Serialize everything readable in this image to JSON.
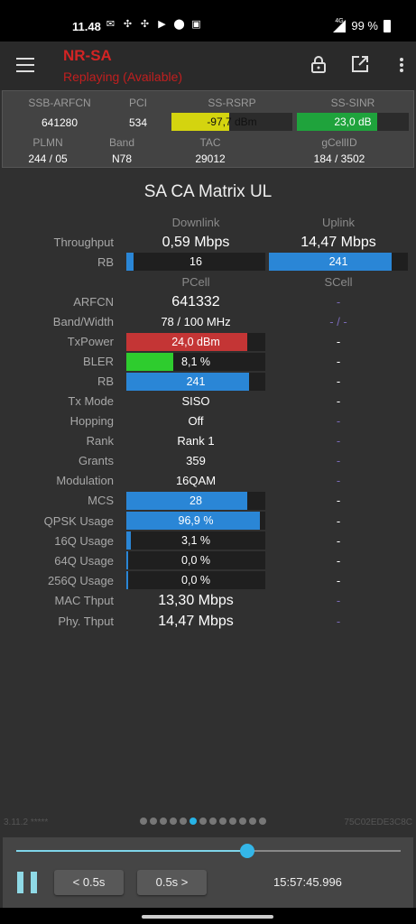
{
  "status_bar": {
    "time": "11.48",
    "network": "4G",
    "battery": "99 %"
  },
  "app_bar": {
    "title": "NR-SA",
    "subtitle": "Replaying (Available)"
  },
  "summary": {
    "ssb_arfcn_label": "SSB-ARFCN",
    "ssb_arfcn": "641280",
    "pci_label": "PCI",
    "pci": "534",
    "rsrp_label": "SS-RSRP",
    "rsrp": "-97,7 dBm",
    "rsrp_level": 0.48,
    "rsrp_color": "#d4d40f",
    "sinr_label": "SS-SINR",
    "sinr": "23,0 dB",
    "sinr_level": 0.72,
    "sinr_color": "#1fa33c",
    "plmn_label": "PLMN",
    "plmn": "244 / 05",
    "band_label": "Band",
    "band": "N78",
    "tac_label": "TAC",
    "tac": "29012",
    "gcellid_label": "gCellID",
    "gcellid": "184 / 3502"
  },
  "section_title": "SA CA Matrix UL",
  "headers": {
    "downlink": "Downlink",
    "uplink": "Uplink",
    "pcell": "PCell",
    "scell": "SCell"
  },
  "throughput": {
    "label": "Throughput",
    "downlink": "0,59 Mbps",
    "uplink": "14,47 Mbps"
  },
  "rb_top": {
    "label": "RB",
    "downlink": "16",
    "downlink_level": 0.05,
    "uplink": "241",
    "uplink_level": 0.88
  },
  "rows": {
    "arfcn": {
      "label": "ARFCN",
      "pcell": "641332",
      "scell": "-"
    },
    "band_width": {
      "label": "Band/Width",
      "pcell": "78 / 100 MHz",
      "scell": "- / -"
    },
    "txpower": {
      "label": "TxPower",
      "pcell": "24,0 dBm",
      "level": 0.87,
      "color": "#c43535",
      "scell": "-"
    },
    "bler": {
      "label": "BLER",
      "pcell": "8,1 %",
      "level": 0.34,
      "color": "#2ecc2e",
      "scell": "-"
    },
    "rb": {
      "label": "RB",
      "pcell": "241",
      "level": 0.88,
      "color": "#2a86d6",
      "scell": "-"
    },
    "tx_mode": {
      "label": "Tx Mode",
      "pcell": "SISO",
      "scell": "-"
    },
    "hopping": {
      "label": "Hopping",
      "pcell": "Off",
      "scell": "-"
    },
    "rank": {
      "label": "Rank",
      "pcell": "Rank 1",
      "scell": "-"
    },
    "grants": {
      "label": "Grants",
      "pcell": "359",
      "scell": "-"
    },
    "modulation": {
      "label": "Modulation",
      "pcell": "16QAM",
      "scell": "-"
    },
    "mcs": {
      "label": "MCS",
      "pcell": "28",
      "level": 0.87,
      "color": "#2a86d6",
      "scell": "-"
    },
    "qpsk": {
      "label": "QPSK Usage",
      "pcell": "96,9 %",
      "level": 0.96,
      "color": "#2a86d6",
      "scell": "-"
    },
    "q16": {
      "label": "16Q Usage",
      "pcell": "3,1 %",
      "level": 0.03,
      "color": "#2a86d6",
      "scell": "-"
    },
    "q64": {
      "label": "64Q Usage",
      "pcell": "0,0 %",
      "level": 0.015,
      "color": "#2a86d6",
      "scell": "-"
    },
    "q256": {
      "label": "256Q Usage",
      "pcell": "0,0 %",
      "level": 0.015,
      "color": "#2a86d6",
      "scell": "-"
    },
    "mac_thput": {
      "label": "MAC Thput",
      "pcell": "13,30 Mbps",
      "scell": "-"
    },
    "phy_thput": {
      "label": "Phy. Thput",
      "pcell": "14,47 Mbps",
      "scell": "-"
    }
  },
  "footer": {
    "version": "3.11.2 *****",
    "hash": "75C02EDE3C8C",
    "page_count": 13,
    "active_page": 5
  },
  "player": {
    "progress": 0.6,
    "back_label": "< 0.5s",
    "fwd_label": "0.5s >",
    "timestamp": "15:57:45.996"
  }
}
